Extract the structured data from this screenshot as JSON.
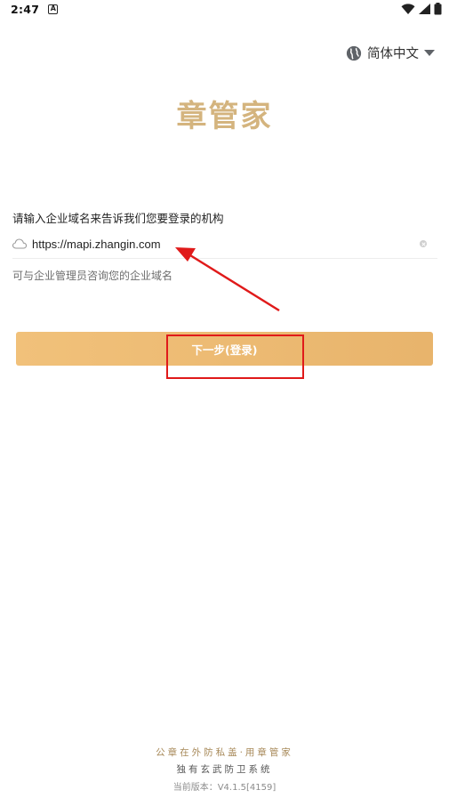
{
  "status_bar": {
    "time": "2:47",
    "notification_glyph": "A"
  },
  "language": {
    "label": "简体中文"
  },
  "brand": {
    "logo_text": "章管家",
    "logo_color": "#d4b47e"
  },
  "form": {
    "prompt": "请输入企业域名来告诉我们您要登录的机构",
    "domain_value": "https://mapi.zhangin.com",
    "hint": "可与企业管理员咨询您的企业域名"
  },
  "actions": {
    "next_label": "下一步(登录)"
  },
  "annotation": {
    "color": "#e01a1a"
  },
  "footer": {
    "slogan": "公章在外防私盖·用章管家",
    "subtitle": "独有玄武防卫系统",
    "version": "当前版本：V4.1.5[4159]"
  }
}
